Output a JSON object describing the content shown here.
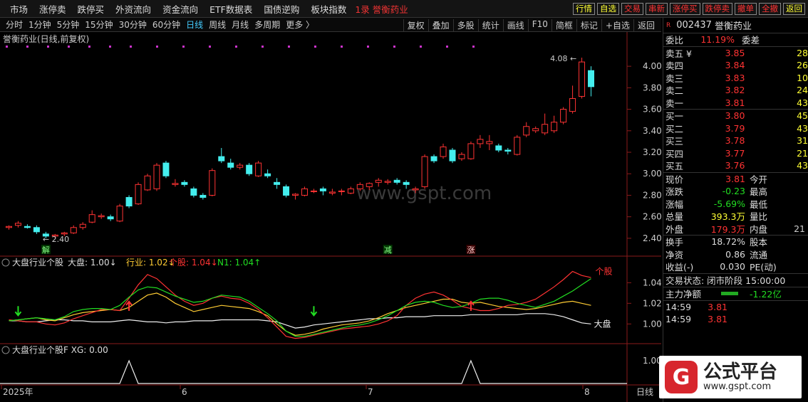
{
  "nav": [
    "市场",
    "涨停卖",
    "跌停买",
    "外资流向",
    "资金流向",
    "ETF数据表",
    "国债逆购",
    "板块指数"
  ],
  "nav_stock": "1录 誉衡药业",
  "top_buttons": [
    "行情",
    "自选",
    "交易",
    "串新",
    "涨停买",
    "跌停卖",
    "撤单",
    "全撤",
    "返回"
  ],
  "periods": [
    "分时",
    "1分钟",
    "5分钟",
    "15分钟",
    "30分钟",
    "60分钟",
    "日线",
    "周线",
    "月线",
    "多周期",
    "更多 〉"
  ],
  "tools": [
    "复权",
    "叠加",
    "多股",
    "统计",
    "画线",
    "F10",
    "简框",
    "标记",
    "+自选",
    "返回"
  ],
  "chart_title": "誉衡药业(日线,前复权)",
  "price_ticks": [
    "4.00",
    "3.80",
    "3.60",
    "3.40",
    "3.20",
    "3.00",
    "2.80",
    "2.60",
    "2.40"
  ],
  "high_label": "4.08",
  "low_label": "2.40",
  "watermark": "www.gspt.com",
  "markers": [
    "解",
    "减",
    "涨"
  ],
  "ind1": {
    "name": "大盘行业个股",
    "items": [
      {
        "t": "大盘: 1.00↓",
        "c": "#ddd"
      },
      {
        "t": "行业: 1.02↓",
        "c": "#fc3"
      },
      {
        "t": "个股: 1.04↓",
        "c": "#f33"
      },
      {
        "t": "N1: 1.04↑",
        "c": "#2d2"
      }
    ],
    "ticks": [
      "1.04",
      "1.02",
      "1.00"
    ],
    "label_stock": "个股",
    "label_market": "大盘"
  },
  "ind2": {
    "name": "大盘行业个股F XG: 0.00",
    "tick": "1.00"
  },
  "x_labels": [
    "2025年",
    "6",
    "7",
    "8"
  ],
  "x_mode": "日线",
  "quote": {
    "code": "002437",
    "name": "誉衡药业",
    "ratio_label": "委比",
    "ratio": "11.19%",
    "diff_label": "委差",
    "sells": [
      [
        "卖五 ¥",
        "3.85",
        "28"
      ],
      [
        "卖四",
        "3.84",
        "26"
      ],
      [
        "卖三",
        "3.83",
        "10"
      ],
      [
        "卖二",
        "3.82",
        "24"
      ],
      [
        "卖一",
        "3.81",
        "43"
      ]
    ],
    "buys": [
      [
        "买一",
        "3.80",
        "45"
      ],
      [
        "买二",
        "3.79",
        "43"
      ],
      [
        "买三",
        "3.78",
        "31"
      ],
      [
        "买四",
        "3.77",
        "21"
      ],
      [
        "买五",
        "3.76",
        "43"
      ]
    ],
    "stats": [
      [
        "现价",
        "3.81",
        "今开",
        ""
      ],
      [
        "涨跌",
        "-0.23",
        "最高",
        ""
      ],
      [
        "涨幅",
        "-5.69%",
        "最低",
        ""
      ],
      [
        "总量",
        "393.3万",
        "量比",
        ""
      ],
      [
        "外盘",
        "179.3万",
        "内盘",
        "21"
      ]
    ],
    "stats2": [
      [
        "换手",
        "18.72%",
        "股本",
        ""
      ],
      [
        "净资",
        "0.86",
        "流通",
        ""
      ],
      [
        "收益(-)",
        "0.030",
        "PE(动)",
        ""
      ]
    ],
    "status": "交易状态: 闭市阶段 15:00:00",
    "flow_label": "主力净额",
    "flow": "-1.22亿",
    "ticks": [
      [
        "14:59",
        "3.81"
      ],
      [
        "14:59",
        "3.81"
      ]
    ]
  },
  "logo": {
    "t1": "公式平台",
    "t2": "www.gspt.com"
  },
  "chart_data": {
    "type": "candlestick",
    "y_range": [
      2.3,
      4.12
    ],
    "candles": [
      [
        2.5,
        2.52,
        2.48,
        2.51
      ],
      [
        2.52,
        2.56,
        2.5,
        2.54
      ],
      [
        2.51,
        2.53,
        2.49,
        2.5
      ],
      [
        2.5,
        2.52,
        2.44,
        2.46
      ],
      [
        2.44,
        2.46,
        2.4,
        2.42
      ],
      [
        2.42,
        2.44,
        2.4,
        2.43
      ],
      [
        2.44,
        2.46,
        2.42,
        2.45
      ],
      [
        2.45,
        2.52,
        2.44,
        2.5
      ],
      [
        2.5,
        2.55,
        2.48,
        2.53
      ],
      [
        2.55,
        2.66,
        2.54,
        2.62
      ],
      [
        2.6,
        2.63,
        2.58,
        2.61
      ],
      [
        2.6,
        2.62,
        2.56,
        2.58
      ],
      [
        2.56,
        2.72,
        2.55,
        2.7
      ],
      [
        2.78,
        2.8,
        2.68,
        2.7
      ],
      [
        2.72,
        2.92,
        2.71,
        2.9
      ],
      [
        2.85,
        3.0,
        2.84,
        2.98
      ],
      [
        2.86,
        3.1,
        2.84,
        3.08
      ],
      [
        3.1,
        3.12,
        2.96,
        2.98
      ],
      [
        2.9,
        2.95,
        2.88,
        2.91
      ],
      [
        2.92,
        2.94,
        2.88,
        2.9
      ],
      [
        2.86,
        2.88,
        2.78,
        2.8
      ],
      [
        2.8,
        2.82,
        2.76,
        2.78
      ],
      [
        2.8,
        3.05,
        2.79,
        3.03
      ],
      [
        3.16,
        3.24,
        3.1,
        3.12
      ],
      [
        3.1,
        3.14,
        3.04,
        3.06
      ],
      [
        3.06,
        3.1,
        3.04,
        3.08
      ],
      [
        3.08,
        3.1,
        2.98,
        3.0
      ],
      [
        2.98,
        3.12,
        2.97,
        3.1
      ],
      [
        3.0,
        3.04,
        2.96,
        2.98
      ],
      [
        2.92,
        2.96,
        2.86,
        2.9
      ],
      [
        2.88,
        2.9,
        2.78,
        2.8
      ],
      [
        2.8,
        2.82,
        2.76,
        2.81
      ],
      [
        2.8,
        2.88,
        2.79,
        2.86
      ],
      [
        2.84,
        2.86,
        2.82,
        2.84
      ],
      [
        2.86,
        2.88,
        2.8,
        2.84
      ],
      [
        2.82,
        2.86,
        2.8,
        2.83
      ],
      [
        2.84,
        2.86,
        2.8,
        2.84
      ],
      [
        2.82,
        2.88,
        2.81,
        2.86
      ],
      [
        2.86,
        2.92,
        2.84,
        2.9
      ],
      [
        2.88,
        2.92,
        2.85,
        2.91
      ],
      [
        2.92,
        2.96,
        2.88,
        2.94
      ],
      [
        2.92,
        2.95,
        2.9,
        2.93
      ],
      [
        2.94,
        2.96,
        2.9,
        2.92
      ],
      [
        2.92,
        2.94,
        2.86,
        2.9
      ],
      [
        2.85,
        2.88,
        2.82,
        2.86
      ],
      [
        2.88,
        3.18,
        2.86,
        3.16
      ],
      [
        3.16,
        3.18,
        3.1,
        3.12
      ],
      [
        3.16,
        3.28,
        3.14,
        3.25
      ],
      [
        3.22,
        3.24,
        3.1,
        3.12
      ],
      [
        3.14,
        3.2,
        3.12,
        3.18
      ],
      [
        3.14,
        3.3,
        3.13,
        3.28
      ],
      [
        3.28,
        3.36,
        3.24,
        3.32
      ],
      [
        3.28,
        3.36,
        3.22,
        3.3
      ],
      [
        3.26,
        3.28,
        3.2,
        3.22
      ],
      [
        3.22,
        3.24,
        3.18,
        3.21
      ],
      [
        3.18,
        3.36,
        3.17,
        3.34
      ],
      [
        3.36,
        3.48,
        3.34,
        3.44
      ],
      [
        3.4,
        3.44,
        3.38,
        3.42
      ],
      [
        3.38,
        3.56,
        3.36,
        3.46
      ],
      [
        3.4,
        3.54,
        3.38,
        3.48
      ],
      [
        3.48,
        3.62,
        3.46,
        3.6
      ],
      [
        3.58,
        3.82,
        3.56,
        3.7
      ],
      [
        3.72,
        4.08,
        3.7,
        4.04
      ],
      [
        3.96,
        4.0,
        3.72,
        3.81
      ]
    ],
    "ind_range": [
      0.985,
      1.052
    ],
    "series": [
      {
        "name": "大盘",
        "values": [
          1.003,
          1.003,
          1.002,
          1.002,
          1.003,
          1.004,
          1.004,
          1.003,
          1.003,
          1.002,
          1.002,
          1.002,
          1.003,
          1.004,
          1.003,
          1.002,
          1.002,
          1.001,
          1.002,
          1.002,
          1.003,
          1.003,
          1.003,
          1.004,
          1.004,
          1.004,
          1.004,
          1.004,
          1.003,
          1.002,
          0.999,
          0.996,
          0.997,
          0.999,
          1.0,
          1.001,
          1.002,
          1.003,
          1.004,
          1.005,
          1.005,
          1.006,
          1.006,
          1.007,
          1.007,
          1.007,
          1.008,
          1.008,
          1.008,
          1.008,
          1.009,
          1.009,
          1.009,
          1.009,
          1.009,
          1.009,
          1.01,
          1.01,
          1.01,
          1.009,
          1.007,
          1.004,
          1.001,
          1.0
        ]
      },
      {
        "name": "行业",
        "values": [
          1.003,
          1.004,
          1.005,
          1.006,
          1.004,
          1.003,
          1.006,
          1.009,
          1.011,
          1.012,
          1.013,
          1.014,
          1.013,
          1.016,
          1.022,
          1.028,
          1.03,
          1.026,
          1.02,
          1.016,
          1.012,
          1.014,
          1.016,
          1.018,
          1.017,
          1.016,
          1.015,
          1.012,
          1.008,
          1.0,
          0.993,
          0.989,
          0.99,
          0.992,
          0.995,
          0.997,
          0.999,
          1.0,
          1.001,
          1.003,
          1.006,
          1.01,
          1.013,
          1.016,
          1.018,
          1.02,
          1.022,
          1.024,
          1.024,
          1.021,
          1.02,
          1.021,
          1.019,
          1.017,
          1.016,
          1.015,
          1.014,
          1.015,
          1.017,
          1.019,
          1.021,
          1.022,
          1.02,
          1.018
        ]
      },
      {
        "name": "个股",
        "values": [
          1.004,
          1.003,
          1.002,
          1.002,
          1.0,
          0.999,
          1.001,
          1.005,
          1.008,
          1.011,
          1.014,
          1.014,
          1.013,
          1.025,
          1.038,
          1.048,
          1.044,
          1.036,
          1.028,
          1.022,
          1.018,
          1.02,
          1.025,
          1.027,
          1.025,
          1.024,
          1.02,
          1.014,
          1.006,
          0.997,
          0.988,
          0.986,
          0.987,
          0.989,
          0.991,
          0.993,
          0.995,
          0.996,
          0.997,
          0.998,
          1.0,
          1.003,
          1.008,
          1.018,
          1.025,
          1.029,
          1.031,
          1.028,
          1.023,
          1.017,
          1.015,
          1.013,
          1.013,
          1.015,
          1.018,
          1.019,
          1.021,
          1.024,
          1.03,
          1.036,
          1.043,
          1.051,
          1.047,
          1.045
        ]
      },
      {
        "name": "N1",
        "values": [
          1.003,
          1.004,
          1.005,
          1.006,
          1.005,
          1.004,
          1.007,
          1.012,
          1.014,
          1.015,
          1.015,
          1.014,
          1.018,
          1.026,
          1.033,
          1.036,
          1.035,
          1.031,
          1.027,
          1.024,
          1.021,
          1.022,
          1.025,
          1.028,
          1.027,
          1.026,
          1.022,
          1.016,
          1.01,
          1.003,
          0.993,
          0.988,
          0.988,
          0.99,
          0.992,
          0.994,
          0.996,
          0.998,
          0.999,
          1.001,
          1.004,
          1.008,
          1.013,
          1.018,
          1.021,
          1.022,
          1.021,
          1.018,
          1.016,
          1.017,
          1.02,
          1.024,
          1.025,
          1.025,
          1.023,
          1.02,
          1.018,
          1.016,
          1.019,
          1.022,
          1.027,
          1.032,
          1.038,
          1.044
        ]
      }
    ],
    "xg_peaks": [
      13,
      50
    ],
    "arrows": [
      {
        "i": 1,
        "dir": "down",
        "c": "#2d2"
      },
      {
        "i": 13,
        "dir": "up",
        "c": "#f33"
      },
      {
        "i": 33,
        "dir": "down",
        "c": "#2d2"
      },
      {
        "i": 50,
        "dir": "up",
        "c": "#f33"
      }
    ],
    "marker_pos": [
      4,
      41,
      50
    ]
  }
}
